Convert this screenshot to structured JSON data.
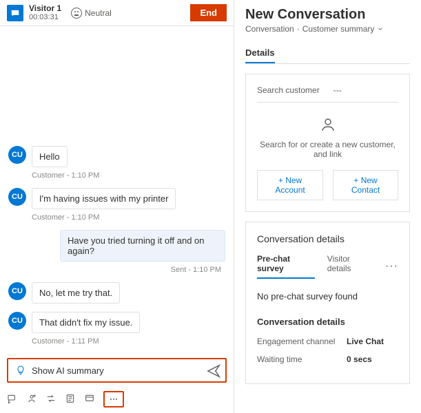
{
  "header": {
    "visitor_label": "Visitor 1",
    "duration": "00:03:31",
    "sentiment": "Neutral",
    "end_label": "End",
    "avatar_initials": "CU"
  },
  "messages": [
    {
      "side": "in",
      "text": "Hello",
      "meta": "Customer - 1:10 PM"
    },
    {
      "side": "in",
      "text": "I'm having issues with my printer",
      "meta": "Customer - 1:10 PM"
    },
    {
      "side": "out",
      "text": "Have you tried turning it off and on again?",
      "meta": "Sent - 1:10 PM"
    },
    {
      "side": "in",
      "text": "No, let me try that.",
      "meta": ""
    },
    {
      "side": "in",
      "text": "That didn't fix my issue.",
      "meta": "Customer - 1:11 PM"
    }
  ],
  "compose": {
    "ai_label": "Show AI summary"
  },
  "right": {
    "title": "New Conversation",
    "crumb_a": "Conversation",
    "crumb_b": "Customer summary",
    "tabs": {
      "details": "Details"
    },
    "customer_card": {
      "search_label": "Search customer",
      "search_value": "---",
      "help": "Search for or create a new customer, and link",
      "new_account": "+ New Account",
      "new_contact": "+ New Contact"
    },
    "conv_card": {
      "title": "Conversation details",
      "subtabs": {
        "a": "Pre-chat survey",
        "b": "Visitor details"
      },
      "empty": "No pre-chat survey found",
      "sub_head": "Conversation details",
      "kv": [
        {
          "k": "Engagement channel",
          "v": "Live Chat"
        },
        {
          "k": "Waiting time",
          "v": "0 secs"
        }
      ]
    }
  }
}
